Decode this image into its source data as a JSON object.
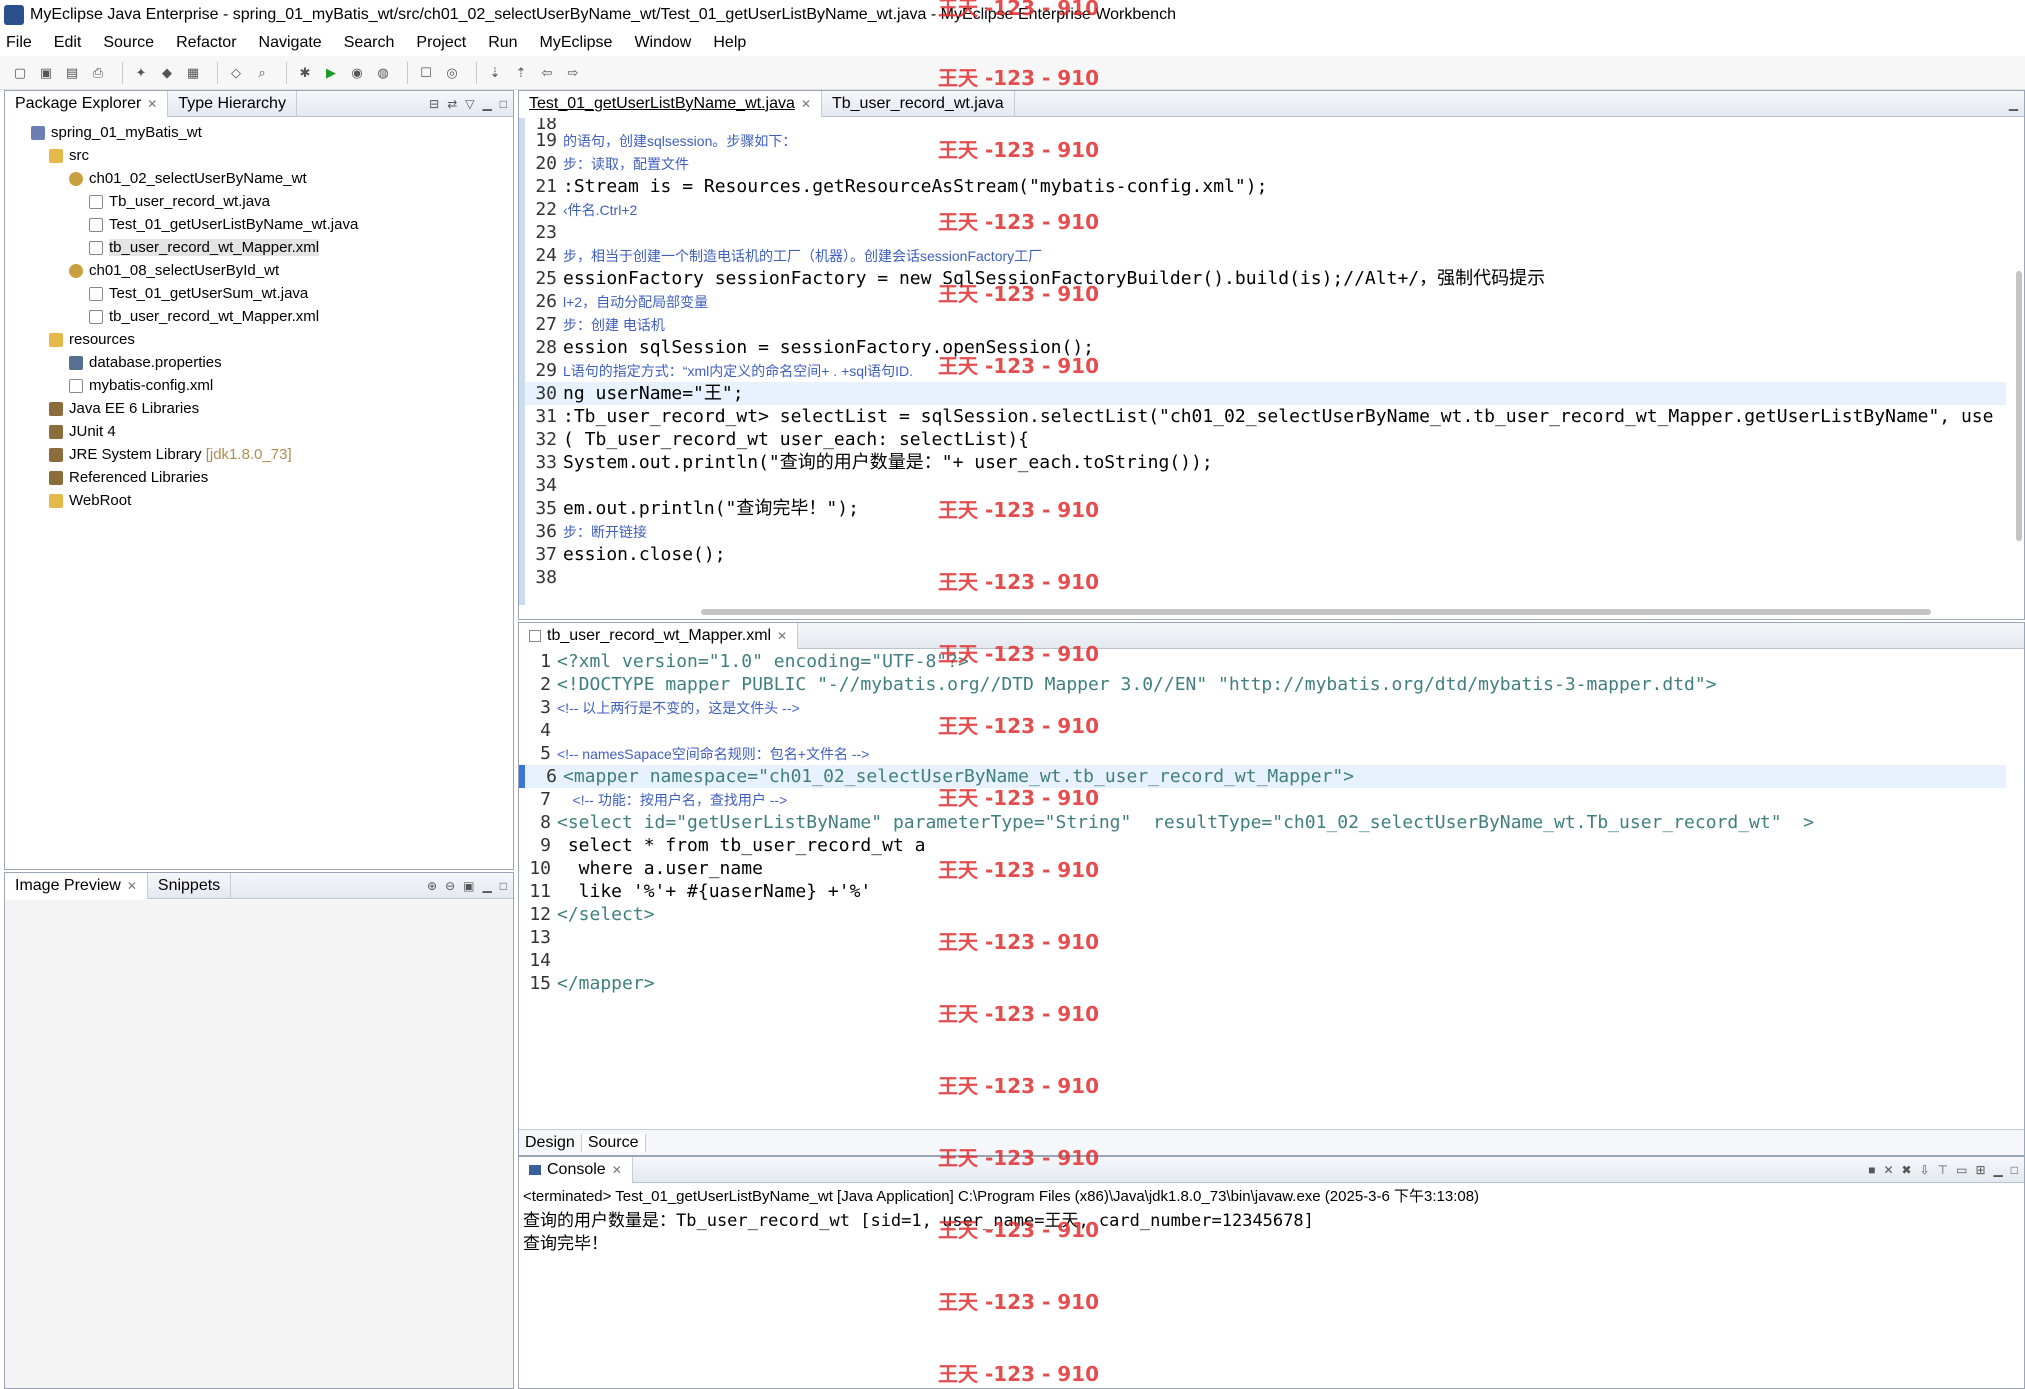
{
  "window": {
    "title": "MyEclipse Java Enterprise - spring_01_myBatis_wt/src/ch01_02_selectUserByName_wt/Test_01_getUserListByName_wt.java - MyEclipse Enterprise Workbench"
  },
  "menubar": {
    "items": [
      {
        "label": "File"
      },
      {
        "label": "Edit"
      },
      {
        "label": "Source"
      },
      {
        "label": "Refactor"
      },
      {
        "label": "Navigate"
      },
      {
        "label": "Search"
      },
      {
        "label": "Project"
      },
      {
        "label": "Run"
      },
      {
        "label": "MyEclipse"
      },
      {
        "label": "Window"
      },
      {
        "label": "Help"
      }
    ]
  },
  "package_explorer": {
    "tab_label": "Package Explorer",
    "tab2_label": "Type Hierarchy",
    "items": [
      {
        "label": "spring_01_myBatis_wt",
        "icon": "project-icon"
      },
      {
        "label": "src",
        "icon": "source-folder-icon"
      },
      {
        "label": "ch01_02_selectUserByName_wt",
        "icon": "package-icon"
      },
      {
        "label": "Tb_user_record_wt.java",
        "icon": "java-file-icon"
      },
      {
        "label": "Test_01_getUserListByName_wt.java",
        "icon": "java-file-icon"
      },
      {
        "label": "tb_user_record_wt_Mapper.xml",
        "icon": "xml-file-icon"
      },
      {
        "label": "ch01_08_selectUserById_wt",
        "icon": "package-icon"
      },
      {
        "label": "Test_01_getUserSum_wt.java",
        "icon": "java-file-icon"
      },
      {
        "label": "tb_user_record_wt_Mapper.xml",
        "icon": "xml-file-icon"
      },
      {
        "label": "resources",
        "icon": "source-folder-icon"
      },
      {
        "label": "database.properties",
        "icon": "properties-file-icon"
      },
      {
        "label": "mybatis-config.xml",
        "icon": "xml-file-icon"
      },
      {
        "label": "Java EE 6 Libraries",
        "icon": "library-icon"
      },
      {
        "label": "JUnit 4",
        "icon": "library-icon"
      },
      {
        "label": "JRE System Library",
        "suffix": "[jdk1.8.0_73]",
        "icon": "library-icon"
      },
      {
        "label": "Referenced Libraries",
        "icon": "library-icon"
      },
      {
        "label": "WebRoot",
        "icon": "folder-icon"
      }
    ]
  },
  "image_preview": {
    "tab_label": "Image Preview",
    "tab2_label": "Snippets"
  },
  "java_editor": {
    "tab1": "Test_01_getUserListByName_wt.java",
    "tab2": "Tb_user_record_wt.java",
    "lines": [
      {
        "n": "18",
        "text": ""
      },
      {
        "n": "19",
        "text": "的语句，创建sqlsession。步骤如下："
      },
      {
        "n": "20",
        "text": "步：读取，配置文件"
      },
      {
        "n": "21",
        "text": ":Stream is = Resources.getResourceAsStream(\"mybatis-config.xml\");"
      },
      {
        "n": "22",
        "text": "‹件名.Ctrl+2"
      },
      {
        "n": "23",
        "text": ""
      },
      {
        "n": "24",
        "text": "步，相当于创建一个制造电话机的工厂（机器）。创建会话sessionFactory工厂"
      },
      {
        "n": "25",
        "text": "essionFactory sessionFactory = new SqlSessionFactoryBuilder().build(is);//Alt+/，强制代码提示"
      },
      {
        "n": "26",
        "text": "l+2，自动分配局部变量"
      },
      {
        "n": "27",
        "text": "步：创建 电话机"
      },
      {
        "n": "28",
        "text": "ession sqlSession = sessionFactory.openSession();"
      },
      {
        "n": "29",
        "text": "L语句的指定方式：“xml内定义的命名空间+ . +sql语句ID."
      },
      {
        "n": "30",
        "text": "ng userName=\"王\";"
      },
      {
        "n": "31",
        "text": ":Tb_user_record_wt> selectList = sqlSession.selectList(\"ch01_02_selectUserByName_wt.tb_user_record_wt_Mapper.getUserListByName\", use"
      },
      {
        "n": "32",
        "text": "( Tb_user_record_wt user_each: selectList){"
      },
      {
        "n": "33",
        "text": "System.out.println(\"查询的用户数量是：\"+ user_each.toString());"
      },
      {
        "n": "34",
        "text": ""
      },
      {
        "n": "35",
        "text": "em.out.println(\"查询完毕！\");"
      },
      {
        "n": "36",
        "text": "步：断开链接"
      },
      {
        "n": "37",
        "text": "ession.close();"
      },
      {
        "n": "38",
        "text": ""
      }
    ]
  },
  "xml_editor": {
    "tab": "tb_user_record_wt_Mapper.xml",
    "lines": [
      {
        "n": "1",
        "text": "<?xml version=\"1.0\" encoding=\"UTF-8\"?>"
      },
      {
        "n": "2",
        "text": "<!DOCTYPE mapper PUBLIC \"-//mybatis.org//DTD Mapper 3.0//EN\" \"http://mybatis.org/dtd/mybatis-3-mapper.dtd\">"
      },
      {
        "n": "3",
        "text": "<!-- 以上两行是不变的，这是文件头 -->"
      },
      {
        "n": "4",
        "text": ""
      },
      {
        "n": "5",
        "text": "<!-- namesSapace空间命名规则：包名+文件名 -->"
      },
      {
        "n": "6",
        "text": "<mapper namespace=\"ch01_02_selectUserByName_wt.tb_user_record_wt_Mapper\">"
      },
      {
        "n": "7",
        "text": "    <!-- 功能：按用户名，查找用户 -->"
      },
      {
        "n": "8",
        "text": "<select id=\"getUserListByName\" parameterType=\"String\"  resultType=\"ch01_02_selectUserByName_wt.Tb_user_record_wt\"  >"
      },
      {
        "n": "9",
        "text": " select * from tb_user_record_wt a"
      },
      {
        "n": "10",
        "text": "  where a.user_name"
      },
      {
        "n": "11",
        "text": "  like '%'+ #{uaserName} +'%'"
      },
      {
        "n": "12",
        "text": "</select>"
      },
      {
        "n": "13",
        "text": ""
      },
      {
        "n": "14",
        "text": ""
      },
      {
        "n": "15",
        "text": "</mapper>"
      }
    ],
    "bottom_tabs": [
      "Design",
      "Source"
    ]
  },
  "console": {
    "tab_label": "Console",
    "status": "<terminated> Test_01_getUserListByName_wt [Java Application] C:\\Program Files (x86)\\Java\\jdk1.8.0_73\\bin\\javaw.exe (2025-3-6 下午3:13:08)",
    "output": [
      "查询的用户数量是：Tb_user_record_wt [sid=1, user_name=王天, card_number=12345678]",
      "查询完毕！"
    ]
  },
  "watermark_text": "王天 -123 - 910"
}
